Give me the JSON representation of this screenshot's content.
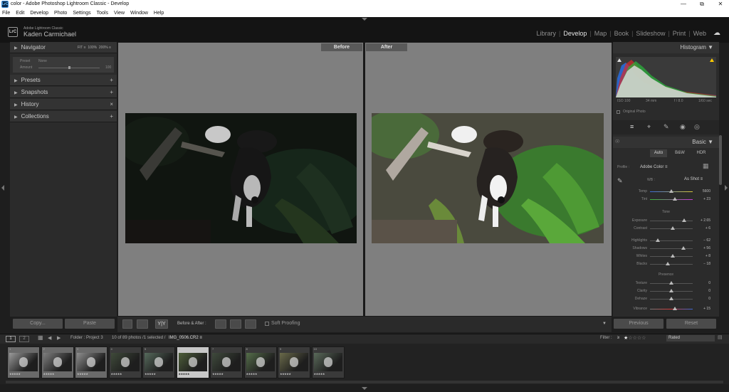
{
  "window": {
    "title": "color - Adobe Photoshop Lightroom Classic - Develop",
    "app_icon": "LrC"
  },
  "menu": [
    "File",
    "Edit",
    "Develop",
    "Photo",
    "Settings",
    "Tools",
    "View",
    "Window",
    "Help"
  ],
  "identity": {
    "product": "Adobe Lightroom Classic",
    "user": "Kaden Carmichael",
    "logo": "LrC"
  },
  "modules": {
    "items": [
      "Library",
      "Develop",
      "Map",
      "Book",
      "Slideshow",
      "Print",
      "Web"
    ],
    "active": "Develop"
  },
  "left_panel": {
    "navigator": {
      "label": "Navigator",
      "opts": [
        "FIT ≡",
        "100%",
        "200% ≡"
      ]
    },
    "preset_amount": {
      "preset_label": "Preset",
      "preset_value": "None",
      "amount_label": "Amount",
      "amount_value": "100"
    },
    "sections": [
      {
        "label": "Presets",
        "action": "+"
      },
      {
        "label": "Snapshots",
        "action": "+"
      },
      {
        "label": "History",
        "action": "×"
      },
      {
        "label": "Collections",
        "action": "+"
      }
    ],
    "copy_label": "Copy...",
    "paste_label": "Paste"
  },
  "view": {
    "before_label": "Before",
    "after_label": "After"
  },
  "toolbar": {
    "mode": "Y|Y",
    "before_after_label": "Before & After :",
    "soft_proofing_label": "Soft Proofing"
  },
  "right_panel": {
    "histogram_label": "Histogram",
    "exif": [
      "ISO 100",
      "34 mm",
      "f / 8.0",
      "1/60 sec"
    ],
    "original_photo_label": "Original Photo",
    "basic_label": "Basic",
    "treatment": [
      "Auto",
      "B&W",
      "HDR"
    ],
    "profile_label": "Profile :",
    "profile_value": "Adobe Color ≡",
    "wb_label": "WB :",
    "wb_value": "As Shot ≡",
    "sliders_wb": [
      {
        "label": "Temp",
        "value": "5600",
        "pos": 0.5
      },
      {
        "label": "Tint",
        "value": "+ 23",
        "pos": 0.58
      }
    ],
    "tone_label": "Tone",
    "sliders_tone": [
      {
        "label": "Exposure",
        "value": "+ 2.65",
        "pos": 0.8
      },
      {
        "label": "Contrast",
        "value": "+ 6",
        "pos": 0.53
      }
    ],
    "sliders_tone2": [
      {
        "label": "Highlights",
        "value": "− 62",
        "pos": 0.19
      },
      {
        "label": "Shadows",
        "value": "+ 56",
        "pos": 0.78
      },
      {
        "label": "Whites",
        "value": "+ 8",
        "pos": 0.54
      },
      {
        "label": "Blacks",
        "value": "− 18",
        "pos": 0.41
      }
    ],
    "presence_label": "Presence",
    "sliders_presence": [
      {
        "label": "Texture",
        "value": "0",
        "pos": 0.5
      },
      {
        "label": "Clarity",
        "value": "0",
        "pos": 0.5
      },
      {
        "label": "Dehaze",
        "value": "0",
        "pos": 0.5
      }
    ],
    "sliders_presence2": [
      {
        "label": "Vibrance",
        "value": "+ 15",
        "pos": 0.58
      }
    ],
    "previous_label": "Previous",
    "reset_label": "Reset"
  },
  "filmstrip_bar": {
    "folder_text": "Folder : Project 3",
    "count_text": "10 of 89 photos /1 selected /",
    "file_text": "IMG_0506.CR2 ≡",
    "filter_label": "Filter :",
    "filter_op": "≥",
    "rating": 1,
    "filter_value": "Rated"
  },
  "filmstrip": [
    {
      "num": "1",
      "stars": "★★★★★",
      "tone": "#9a9a9a",
      "state": "sel"
    },
    {
      "num": "2",
      "stars": "★★★★★",
      "tone": "#7f7f7f",
      "state": "sel"
    },
    {
      "num": "3",
      "stars": "★★★★★",
      "tone": "#8f8f8f",
      "state": "sel"
    },
    {
      "num": "4",
      "stars": "★★★★★",
      "tone": "#3f4a3a",
      "state": ""
    },
    {
      "num": "5",
      "stars": "★★★★★",
      "tone": "#566a5c",
      "state": ""
    },
    {
      "num": "6",
      "stars": "★★★★★",
      "tone": "#4e5f3a",
      "state": "active"
    },
    {
      "num": "7",
      "stars": "★★★★★",
      "tone": "#3f4a3c",
      "state": ""
    },
    {
      "num": "8",
      "stars": "★★★★★",
      "tone": "#556e4a",
      "state": ""
    },
    {
      "num": "9",
      "stars": "★★★★★",
      "tone": "#6a6a4a",
      "state": ""
    },
    {
      "num": "10",
      "stars": "★★★★★",
      "tone": "#5a6a5a",
      "state": ""
    }
  ],
  "colors": {
    "accent": "#ffcc00",
    "panel": "#2b2b2b"
  }
}
